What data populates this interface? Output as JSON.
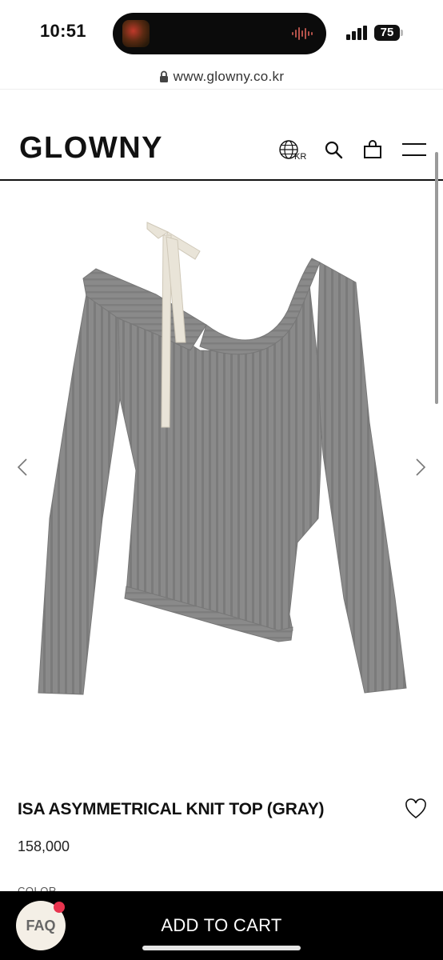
{
  "status_bar": {
    "time": "10:51",
    "battery": "75"
  },
  "browser": {
    "url": "www.glowny.co.kr"
  },
  "header": {
    "logo": "GLOWNY",
    "language": "KR"
  },
  "product": {
    "name": "ISA ASYMMETRICAL KNIT TOP (GRAY)",
    "price": "158,000",
    "color_label": "COLOR",
    "color": "#8a8a8a",
    "ribbon_color": "#e9e4d8"
  },
  "bottom_bar": {
    "cta_label": "ADD TO CART",
    "faq_label": "FAQ"
  },
  "icons": [
    "lock-icon",
    "globe-icon",
    "search-icon",
    "bag-icon",
    "menu-icon",
    "chevron-left-icon",
    "chevron-right-icon",
    "heart-icon"
  ]
}
